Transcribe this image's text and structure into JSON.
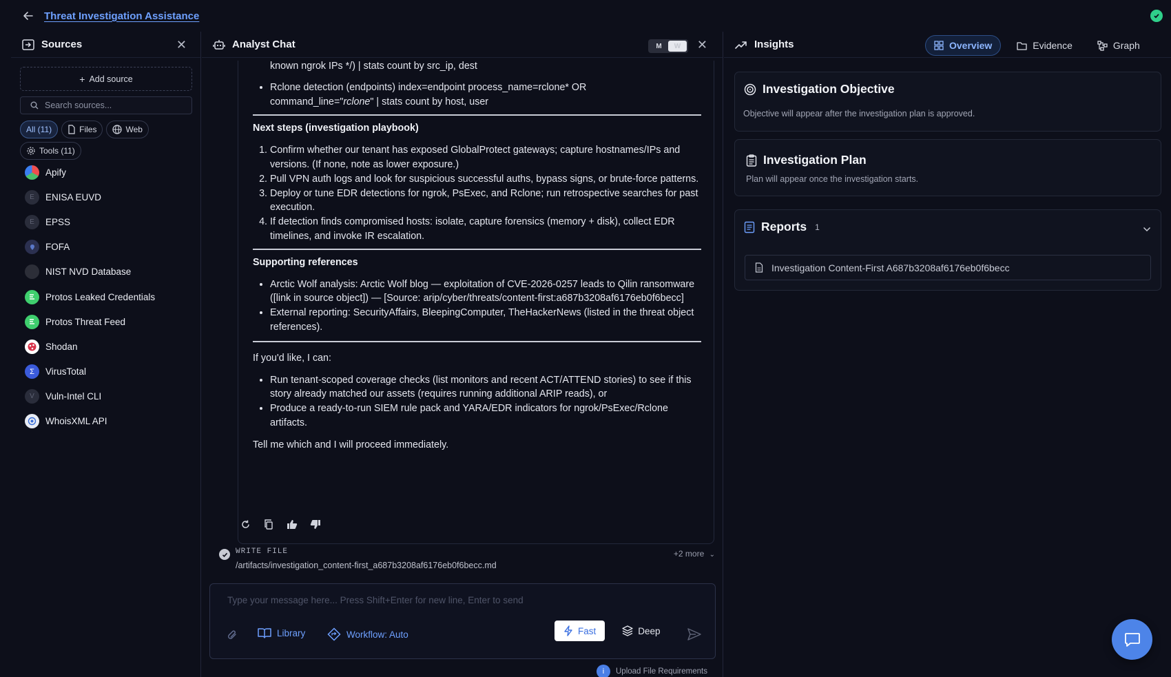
{
  "app": {
    "title": "Threat Investigation Assistance"
  },
  "sources": {
    "title": "Sources",
    "add_label": "Add source",
    "search_placeholder": "Search sources...",
    "chips": [
      "All (11)",
      "Files",
      "Web",
      "Tools (11)"
    ],
    "items": [
      {
        "label": "Apify",
        "icon": "apify-logo"
      },
      {
        "label": "ENISA EUVD",
        "icon": "E"
      },
      {
        "label": "EPSS",
        "icon": "E"
      },
      {
        "label": "FOFA",
        "icon": "fofa-logo"
      },
      {
        "label": "NIST NVD Database",
        "icon": "nist-logo"
      },
      {
        "label": "Protos Leaked Credentials",
        "icon": "protos-logo"
      },
      {
        "label": "Protos Threat Feed",
        "icon": "protos-logo"
      },
      {
        "label": "Shodan",
        "icon": "shodan-logo"
      },
      {
        "label": "VirusTotal",
        "icon": "virustotal-logo"
      },
      {
        "label": "Vuln-Intel CLI",
        "icon": "V"
      },
      {
        "label": "WhoisXML API",
        "icon": "whoisxml-logo"
      }
    ]
  },
  "chat": {
    "title": "Analyst Chat",
    "toggle": [
      "M",
      "W"
    ],
    "message": {
      "q1_line1": "known ngrok IPs */) | stats count by src_ip, dest",
      "q2_line1": "Rclone detection (endpoints) index=endpoint process_name=rclone* OR",
      "q2_line2a": "command_line=\"",
      "q2_line2b": "rclone",
      "q2_line2c": "\" | stats count by host, user",
      "next_steps_title": "Next steps (investigation playbook)",
      "next_steps": [
        "Confirm whether our tenant has exposed GlobalProtect gateways; capture hostnames/IPs and versions. (If none, note as lower exposure.)",
        "Pull VPN auth logs and look for suspicious successful auths, bypass signs, or brute-force patterns.",
        "Deploy or tune EDR detections for ngrok, PsExec, and Rclone; run retrospective searches for past execution.",
        "If detection finds compromised hosts: isolate, capture forensics (memory + disk), collect EDR timelines, and invoke IR escalation."
      ],
      "refs_title": "Supporting references",
      "refs": [
        "Arctic Wolf analysis: Arctic Wolf blog — exploitation of CVE-2026-0257 leads to Qilin ransomware ([link in source object]) — [Source: arip/cyber/threats/content-first:a687b3208af6176eb0f6becc]",
        "External reporting: SecurityAffairs, BleepingComputer, TheHackerNews (listed in the threat object references)."
      ],
      "offer_intro": "If you'd like, I can:",
      "offers": [
        "Run tenant-scoped coverage checks (list monitors and recent ACT/ATTEND stories) to see if this story already matched our assets (requires running additional ARIP reads), or",
        "Produce a ready-to-run SIEM rule pack and YARA/EDR indicators for ngrok/PsExec/Rclone artifacts."
      ],
      "closing": "Tell me which and I will proceed immediately."
    },
    "tool_call": {
      "name": "WRITE FILE",
      "path": "/artifacts/investigation_content-first_a687b3208af6176eb0f6becc.md",
      "more": "+2 more"
    },
    "composer": {
      "placeholder": "Type your message here... Press Shift+Enter for new line, Enter to send",
      "library": "Library",
      "workflow": "Workflow: Auto",
      "fast": "Fast",
      "deep": "Deep"
    },
    "upload_req": "Upload File Requirements"
  },
  "insights": {
    "title": "Insights",
    "tabs": [
      "Overview",
      "Evidence",
      "Graph"
    ],
    "objective": {
      "title": "Investigation Objective",
      "text": "Objective will appear after the investigation plan is approved."
    },
    "plan": {
      "title": "Investigation Plan",
      "text": "Plan will appear once the investigation starts."
    },
    "reports": {
      "title": "Reports",
      "count": "1",
      "items": [
        "Investigation Content-First A687b3208af6176eb0f6becc"
      ]
    }
  },
  "colors": {
    "accent": "#6ea0ff",
    "success": "#2fd08a",
    "fab": "#4d84e8"
  }
}
